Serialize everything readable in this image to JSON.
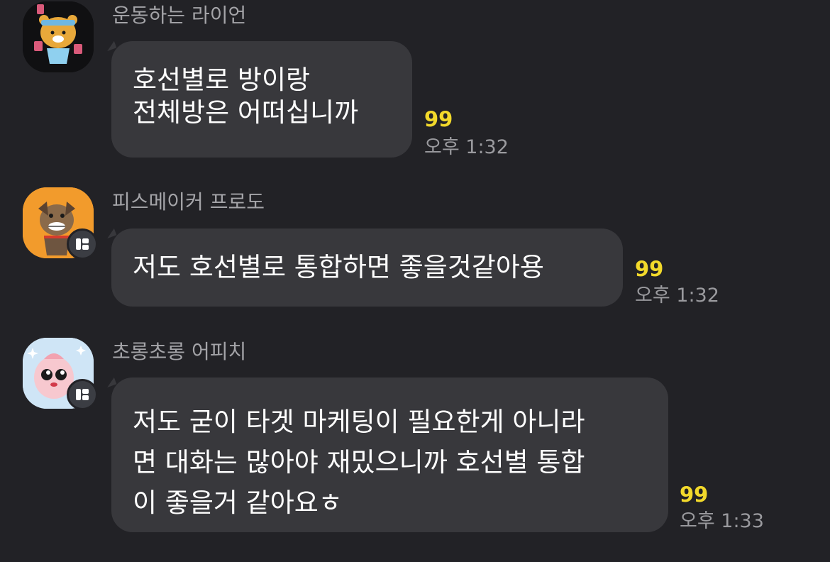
{
  "messages": [
    {
      "sender": "운동하는 라이언",
      "avatar_icon": "ryan-workout-avatar-icon",
      "has_badge": false,
      "lines": [
        "호선별로 방이랑",
        "전체방은 어떠십니까"
      ],
      "unread": "99",
      "time": "오후 1:32"
    },
    {
      "sender": "피스메이커 프로도",
      "avatar_icon": "frodo-dog-avatar-icon",
      "has_badge": true,
      "lines": [
        "저도 호선별로 통합하면 좋을것같아용"
      ],
      "unread": "99",
      "time": "오후 1:32"
    },
    {
      "sender": "초롱초롱 어피치",
      "avatar_icon": "apeach-avatar-icon",
      "has_badge": true,
      "lines": [
        "저도 굳이 타겟 마케팅이 필요한게 아니라",
        "면 대화는 많아야 재밌으니까 호선별 통합",
        "이 좋을거 같아요ㅎ"
      ],
      "unread": "99",
      "time": "오후 1:33"
    }
  ],
  "colors": {
    "background": "#222226",
    "bubble": "#38383c",
    "unread": "#f2d92b",
    "time": "#9a9a9e",
    "sender": "#a4a4a8"
  }
}
